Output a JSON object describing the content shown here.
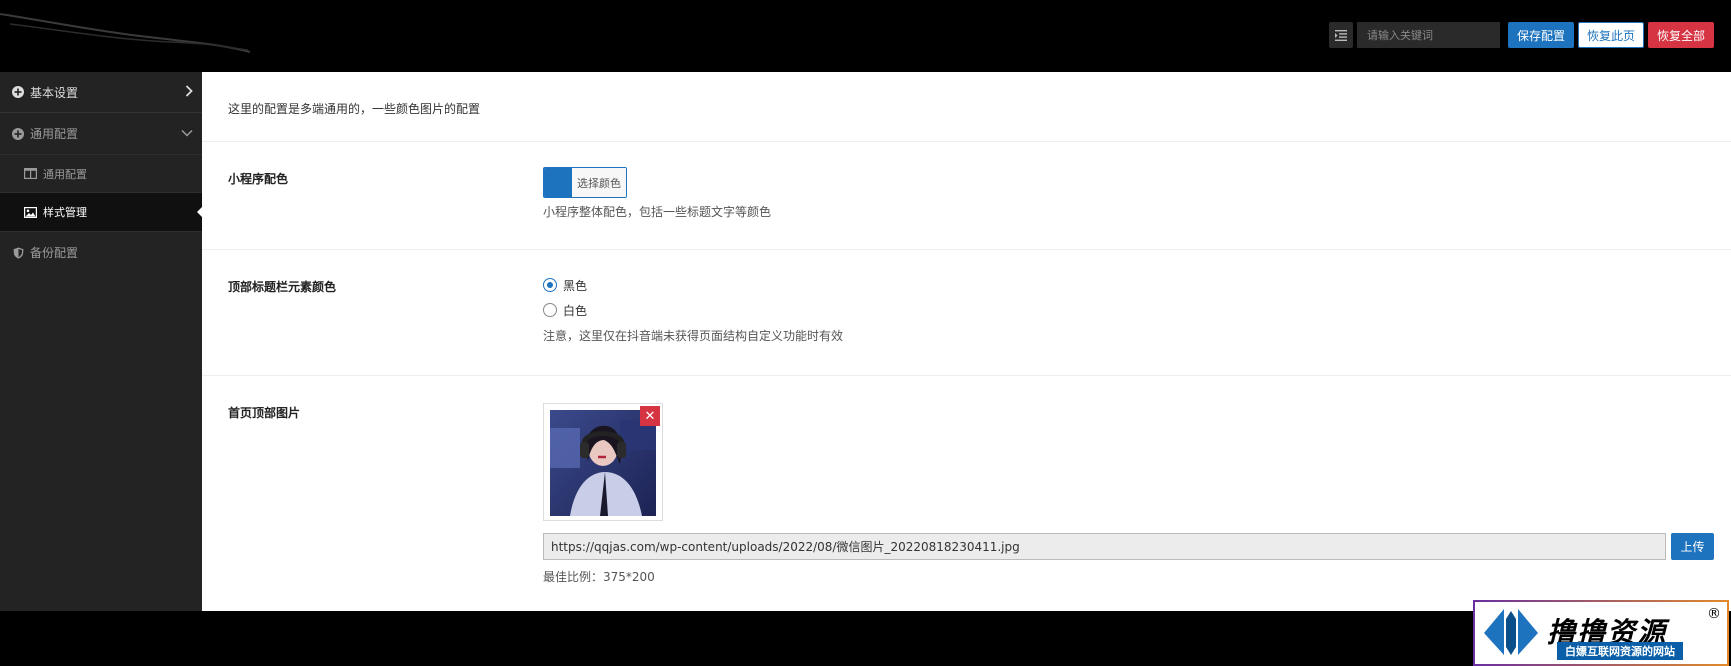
{
  "header": {
    "search_placeholder": "请输入关键词",
    "save_label": "保存配置",
    "restore_page_label": "恢复此页",
    "restore_all_label": "恢复全部"
  },
  "sidebar": {
    "items": [
      {
        "label": "基本设置",
        "icon": "plus-circle-icon"
      },
      {
        "label": "通用配置",
        "icon": "plus-circle-icon"
      },
      {
        "label": "通用配置",
        "icon": "columns-icon"
      },
      {
        "label": "样式管理",
        "icon": "image-icon"
      },
      {
        "label": "备份配置",
        "icon": "shield-icon"
      }
    ]
  },
  "main": {
    "intro": "这里的配置是多端通用的，一些颜色图片的配置",
    "color": {
      "label": "小程序配色",
      "button_label": "选择颜色",
      "value": "#1e73be",
      "hint": "小程序整体配色，包括一些标题文字等颜色"
    },
    "title_bar": {
      "label": "顶部标题栏元素颜色",
      "options": [
        "黑色",
        "白色"
      ],
      "selected": "黑色",
      "hint": "注意，这里仅在抖音端未获得页面结构自定义功能时有效"
    },
    "banner": {
      "label": "首页顶部图片",
      "url": "https://qqjas.com/wp-content/uploads/2022/08/微信图片_20220818230411.jpg",
      "upload_label": "上传",
      "ratio_hint": "最佳比例：375*200"
    }
  },
  "watermark": {
    "title": "撸撸资源",
    "subtitle": "白嫖互联网资源的网站",
    "reg": "®"
  },
  "colors": {
    "primary": "#1e73be",
    "danger": "#d63343",
    "sidebar_bg": "#232323"
  }
}
